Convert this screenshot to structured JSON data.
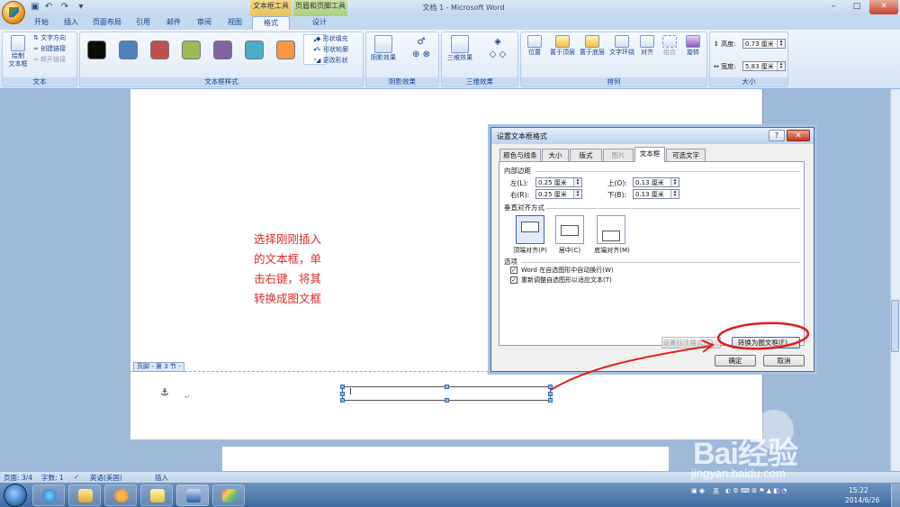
{
  "title_bar": {
    "document_title": "文档 1 - Microsoft Word",
    "context_tab_textbox": "文本框工具",
    "context_tab_headerfooter": "页眉和页脚工具",
    "minimize": "–",
    "maximize": "□",
    "close": "✕"
  },
  "tabs": [
    "开始",
    "插入",
    "页面布局",
    "引用",
    "邮件",
    "审阅",
    "视图",
    "格式",
    "设计"
  ],
  "active_tab": "格式",
  "ribbon": {
    "text_group": {
      "label": "文本",
      "draw_textbox": "绘制\n文本框",
      "text_direction": "文字方向",
      "create_link": "创建链接",
      "break_link": "断开链接"
    },
    "textbox_styles_group": {
      "label": "文本框样式",
      "swatch_colors": [
        "#0a0a0a",
        "#4f81bd",
        "#c0504d",
        "#9bbb59",
        "#8064a2",
        "#4bacc6",
        "#f79646"
      ],
      "shape_fill": "形状填充",
      "shape_outline": "形状轮廓",
      "change_shape": "更改形状"
    },
    "shadow_group": {
      "label": "阴影效果",
      "shadow_effects": "阴影效果"
    },
    "threed_group": {
      "label": "三维效果",
      "threed_effects": "三维效果"
    },
    "arrange_group": {
      "label": "排列",
      "position": "位置",
      "bring_front": "置于顶层",
      "send_back": "置于底层",
      "text_wrap": "文字环绕",
      "align": "对齐",
      "group": "组合",
      "rotate": "旋转"
    },
    "size_group": {
      "label": "大小",
      "height_label": "高度:",
      "height_value": "0.73 厘米",
      "width_label": "宽度:",
      "width_value": "5.83 厘米"
    }
  },
  "document": {
    "annotation_lines": [
      "选择刚刚插入",
      "的文本框，单",
      "击右键，将其",
      "转换成图文框"
    ],
    "footer_tag": "页脚 - 第 3 节 -",
    "anchor_symbol": "⚓",
    "para_mark": "↵"
  },
  "dialog": {
    "title": "设置文本框格式",
    "help": "?",
    "close": "✕",
    "tabs": [
      "颜色与线条",
      "大小",
      "版式",
      "图片",
      "文本框",
      "可选文字"
    ],
    "active_tab": "文本框",
    "disabled_tabs": [
      "图片"
    ],
    "margins_section": "内部边距",
    "left_label": "左(L):",
    "left_value": "0.25 厘米",
    "right_label": "右(R):",
    "right_value": "0.25 厘米",
    "top_label": "上(O):",
    "top_value": "0.13 厘米",
    "bottom_label": "下(B):",
    "bottom_value": "0.13 厘米",
    "vertical_section": "垂直对齐方式",
    "valign_top": "顶端对齐(P)",
    "valign_center": "居中(C)",
    "valign_bottom": "底端对齐(M)",
    "options_section": "选项",
    "opt_wordwrap": "Word 在自选图形中自动换行(W)",
    "opt_resize": "重新调整自选图形以适应文本(T)",
    "format_callout": "设置标注格式(C)...",
    "convert_frame": "转换为图文框(F)...",
    "ok": "确定",
    "cancel": "取消"
  },
  "status_bar": {
    "page": "页面: 3/4",
    "words": "字数: 1",
    "language": "英语(美国)",
    "mode": "插入"
  },
  "taskbar": {
    "ime": "英",
    "time": "15:22",
    "date": "2014/6/26"
  },
  "watermark": {
    "logo": "Bai经验",
    "url": "jingyan.baidu.com"
  }
}
